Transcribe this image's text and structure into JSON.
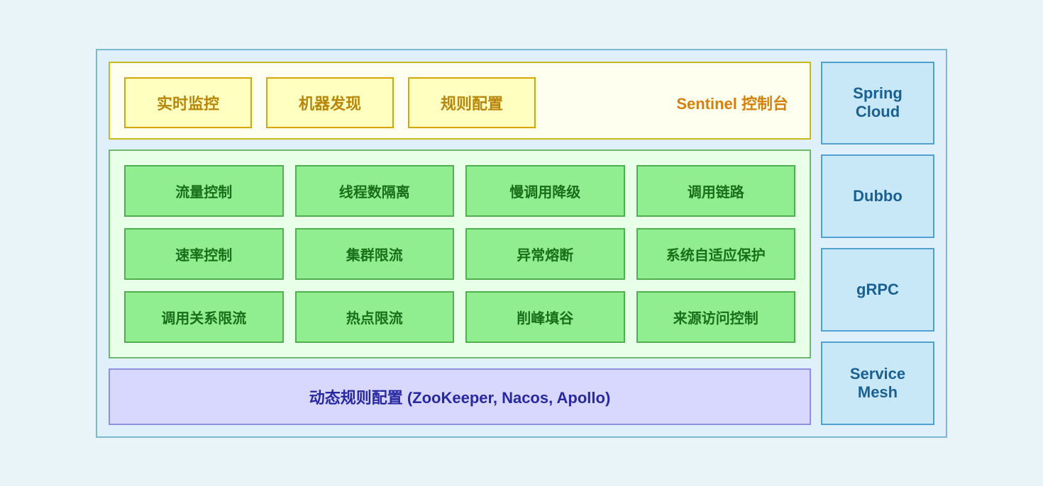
{
  "sentinel_panel": {
    "boxes": [
      "实时监控",
      "机器发现",
      "规则配置"
    ],
    "label": "Sentinel 控制台"
  },
  "features_panel": {
    "rows": [
      [
        "流量控制",
        "线程数隔离",
        "慢调用降级",
        "调用链路"
      ],
      [
        "速率控制",
        "集群限流",
        "异常熔断",
        "系统自适应保护"
      ],
      [
        "调用关系限流",
        "热点限流",
        "削峰填谷",
        "来源访问控制"
      ]
    ]
  },
  "dynamic_panel": {
    "label": "动态规则配置 (ZooKeeper, Nacos, Apollo)"
  },
  "sidebar": {
    "items": [
      "Spring Cloud",
      "Dubbo",
      "gRPC",
      "Service Mesh"
    ]
  }
}
